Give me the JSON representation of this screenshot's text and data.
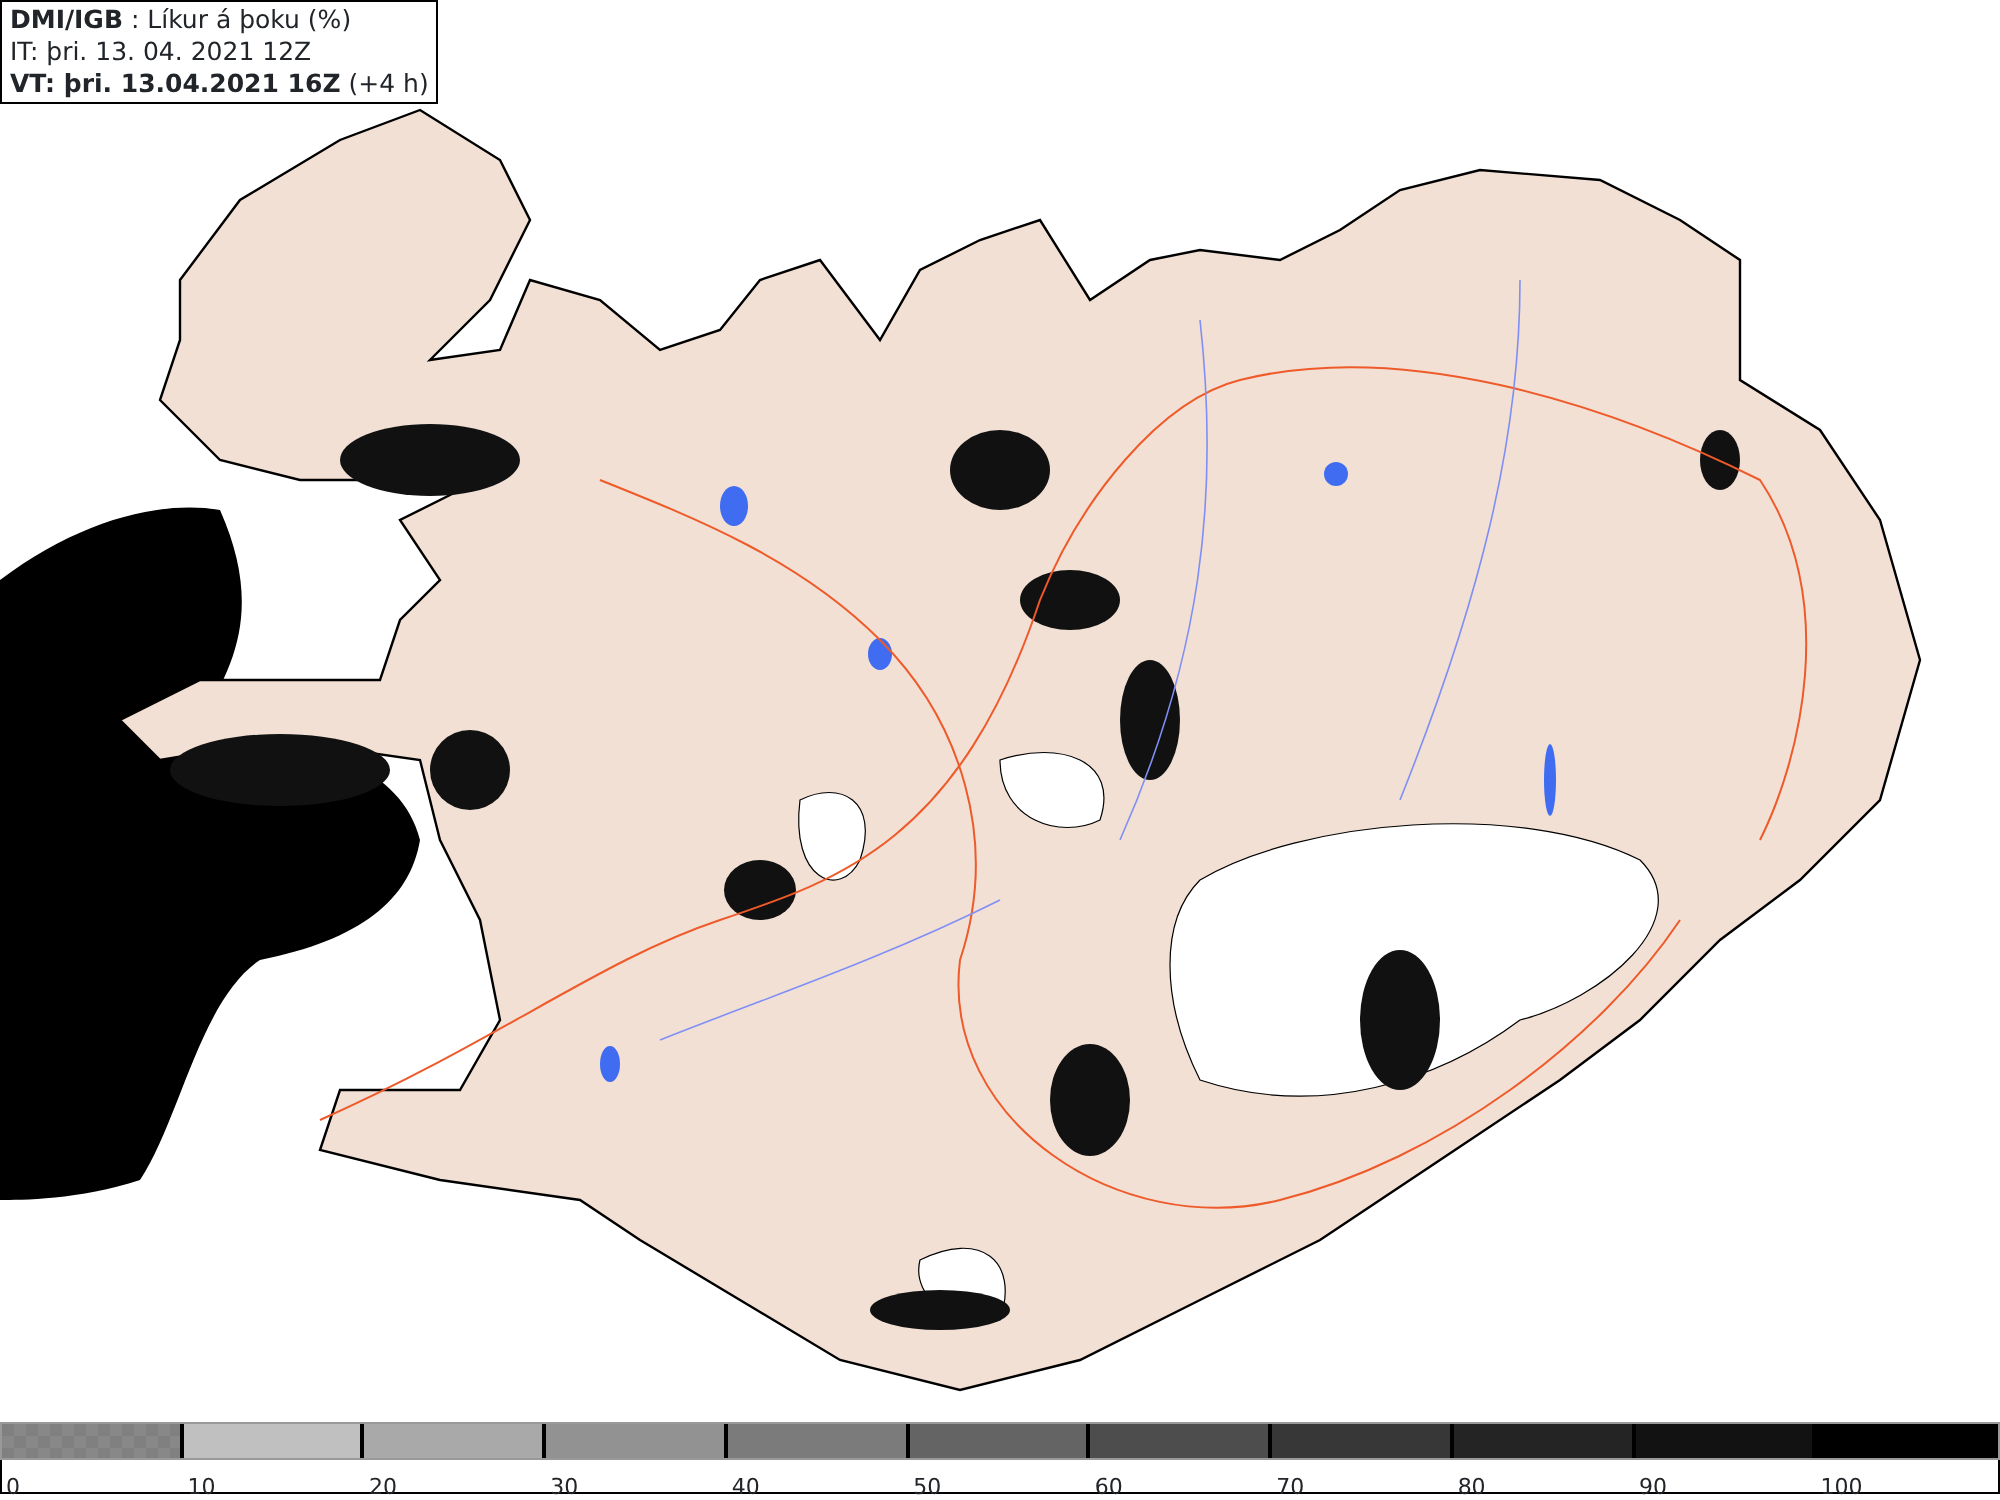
{
  "info_box": {
    "lines": [
      "**DMI/IGB** : Líkur á þoku (%)",
      "IT: þri. 13. 04. 2021 12Z",
      "**VT: þri. 13.04.2021 16Z** (+4 h)"
    ]
  },
  "color_scale": {
    "segments": [
      {
        "kind": "checker",
        "color": "#808080"
      },
      {
        "kind": "solid",
        "color": "#c0c0c0"
      },
      {
        "kind": "solid",
        "color": "#a9a9a9"
      },
      {
        "kind": "solid",
        "color": "#929292"
      },
      {
        "kind": "solid",
        "color": "#7b7b7b"
      },
      {
        "kind": "solid",
        "color": "#646464"
      },
      {
        "kind": "solid",
        "color": "#4d4d4d"
      },
      {
        "kind": "solid",
        "color": "#373737"
      },
      {
        "kind": "solid",
        "color": "#242424"
      },
      {
        "kind": "solid",
        "color": "#121212"
      },
      {
        "kind": "solid",
        "color": "#000000"
      }
    ],
    "ticks": [
      "0",
      "10",
      "20",
      "30",
      "40",
      "50",
      "60",
      "70",
      "80",
      "90",
      "100"
    ]
  }
}
